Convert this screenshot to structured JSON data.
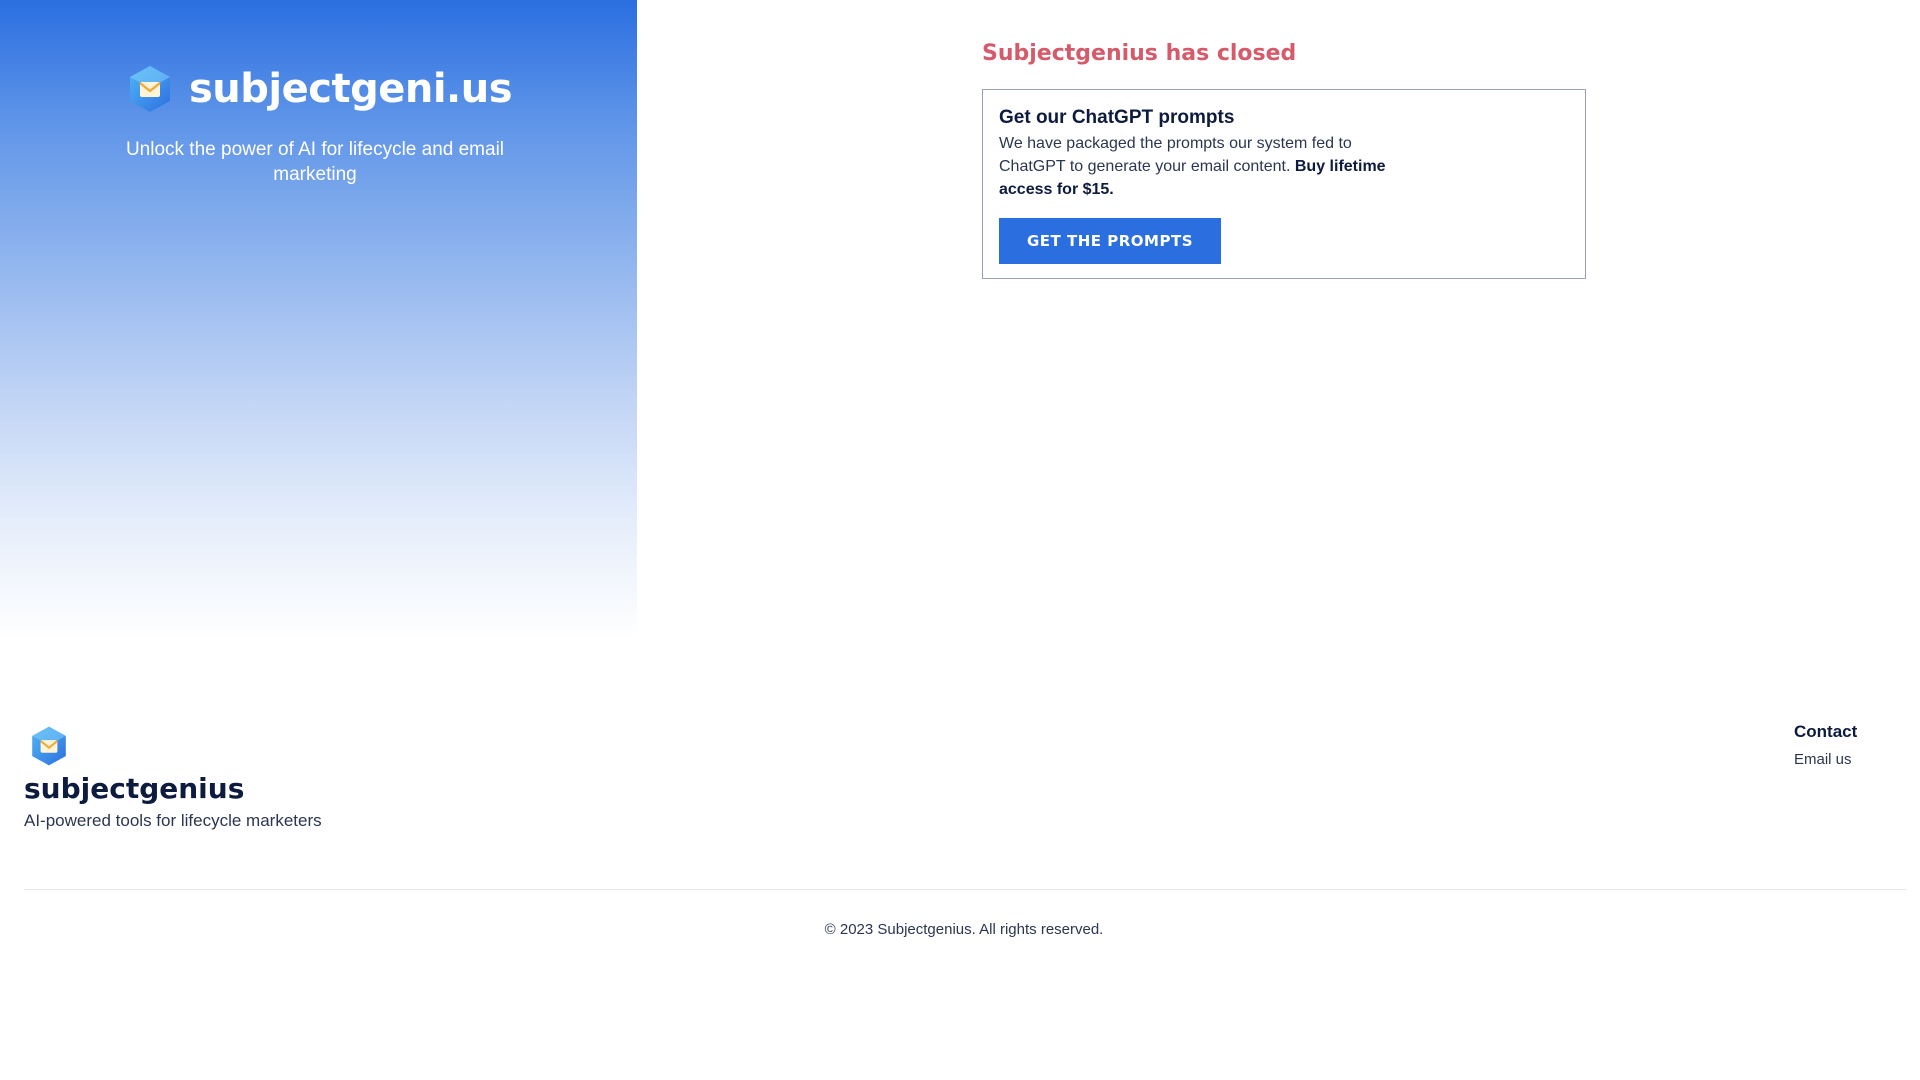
{
  "hero": {
    "brand_name": "subjectgeni.us",
    "tagline": "Unlock the power of AI for lifecycle and email marketing",
    "logo_icon": "envelope-cube-icon"
  },
  "main": {
    "closed_title": "Subjectgenius has closed",
    "card": {
      "title": "Get our ChatGPT prompts",
      "text": "We have packaged the prompts our system fed to ChatGPT to generate your email content.",
      "text_bold": "Buy lifetime access for $15.",
      "button_label": "GET THE PROMPTS"
    }
  },
  "footer": {
    "brand_name": "subjectgenius",
    "tagline": "AI-powered tools for lifecycle marketers",
    "contact_heading": "Contact",
    "contact_link": "Email us",
    "copyright": "© 2023 Subjectgenius. All rights reserved."
  },
  "colors": {
    "accent": "#2a6ee0",
    "closed_title": "#d55b6a",
    "text_dark": "#0d1b3e"
  }
}
